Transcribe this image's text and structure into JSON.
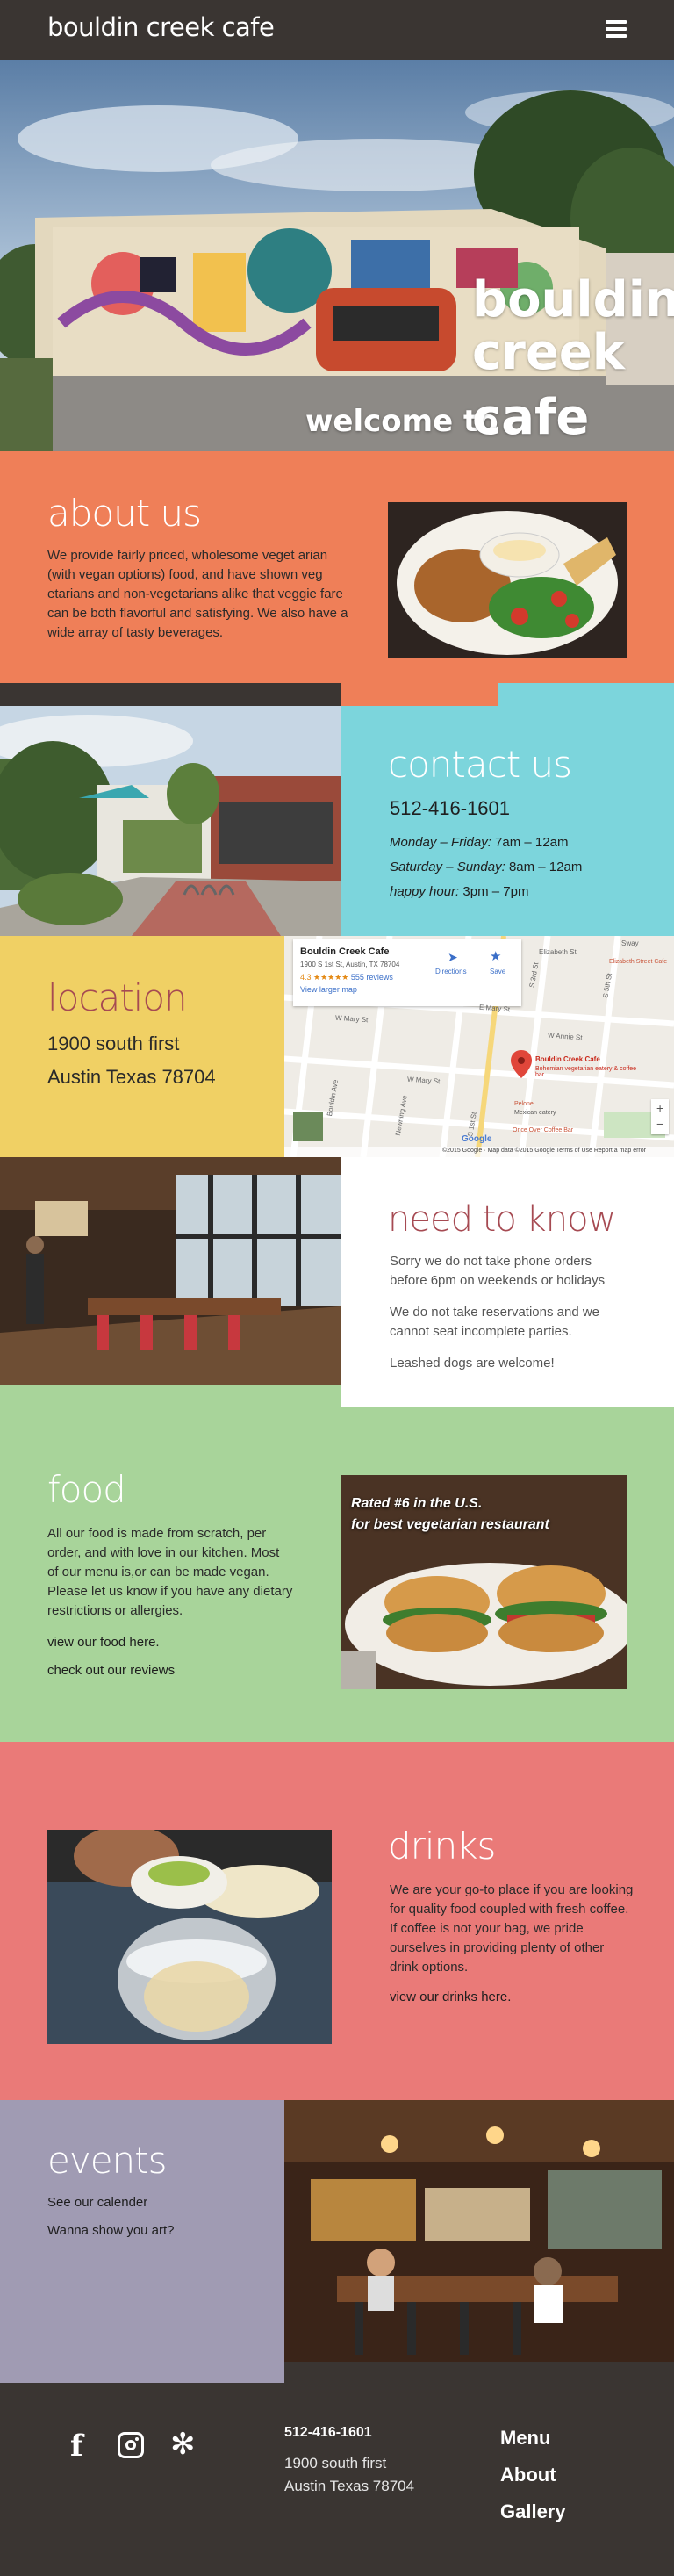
{
  "header": {
    "logo": "bouldin creek cafe",
    "menu_icon": "hamburger-icon"
  },
  "hero": {
    "title_line1": "bouldin",
    "title_line2": "creek",
    "welcome": "welcome to",
    "title_line3": "cafe"
  },
  "about": {
    "title": "about us",
    "text": "We provide fairly priced, wholesome veget arian (with vegan options) food, and have shown veg etarians and non-vegetarians alike that veggie fare can be both flavorful and satisfying. We also have a wide array of tasty beverages."
  },
  "contact": {
    "title": "contact us",
    "phone": "512-416-1601",
    "hours": [
      {
        "days": "Monday – Friday:",
        "time": "7am – 12am"
      },
      {
        "days": "Saturday – Sunday:",
        "time": "8am – 12am"
      },
      {
        "days": "happy hour:",
        "time": "3pm – 7pm"
      }
    ]
  },
  "location": {
    "title": "location",
    "address_line1": "1900 south first",
    "address_line2": "Austin Texas 78704",
    "map": {
      "card_title": "Bouldin Creek Cafe",
      "card_address": "1900 S 1st St, Austin, TX 78704",
      "rating": "4.3",
      "stars": "★★★★★",
      "reviews": "555 reviews",
      "larger_map": "View larger map",
      "directions": "Directions",
      "save": "Save",
      "pin_label": "Bouldin Creek Cafe",
      "pin_sublabel": "Bohemian vegetarian eatery & coffee bar",
      "streets": [
        "W Mary St",
        "W Mary St",
        "W Annie St",
        "E Mary St",
        "Elizabeth St",
        "Bouldin Ave",
        "Newning Ave",
        "S 1st St",
        "S 3rd St",
        "S 5th St",
        "Sway",
        "Elizabeth Street Cafe",
        "Pelone",
        "Once Over Coffee Bar",
        "Mexican eatery"
      ],
      "zoom_in": "+",
      "zoom_out": "−",
      "google": "Google",
      "footer": "©2015 Google · Map data ©2015 Google   Terms of Use   Report a map error"
    }
  },
  "need_to_know": {
    "title": "need to know",
    "p1": "Sorry we do not take phone orders before 6pm on weekends or holidays",
    "p2": "We do not take reservations and we cannot seat incomplete parties.",
    "p3": "Leashed dogs are welcome!"
  },
  "food": {
    "title": "food",
    "text": "All our food is made from scratch, per order, and with love in our kitchen. Most  of our menu is,or can be made vegan. Please let us know if you have any dietary restrictions or allergies.",
    "link1": "view our food here.",
    "link2": "check out our reviews",
    "badge_line1": "Rated #6 in the U.S.",
    "badge_line2": "for best vegetarian  restaurant"
  },
  "drinks": {
    "title": "drinks",
    "text": "We are your go-to place if you are looking for quality food coupled with fresh coffee. If coffee is not your bag, we pride ourselves in providing plenty of other drink options.",
    "link": "view our drinks here."
  },
  "events": {
    "title": "events",
    "link1": "See our calender",
    "link2": "Wanna show you art?"
  },
  "footer": {
    "social_icons": [
      "facebook-icon",
      "instagram-icon",
      "yelp-icon"
    ],
    "phone": "512-416-1601",
    "address_line1": "1900 south first",
    "address_line2": "Austin Texas 78704",
    "nav": [
      "Menu",
      "About",
      "Gallery"
    ]
  },
  "colors": {
    "dark": "#3a3532",
    "orange": "#ef7f58",
    "teal": "#7cd5dc",
    "yellow": "#f0d064",
    "green": "#a8d49a",
    "red": "#ea7a78",
    "purple": "#a09bb3",
    "maroon": "#a64a52"
  }
}
